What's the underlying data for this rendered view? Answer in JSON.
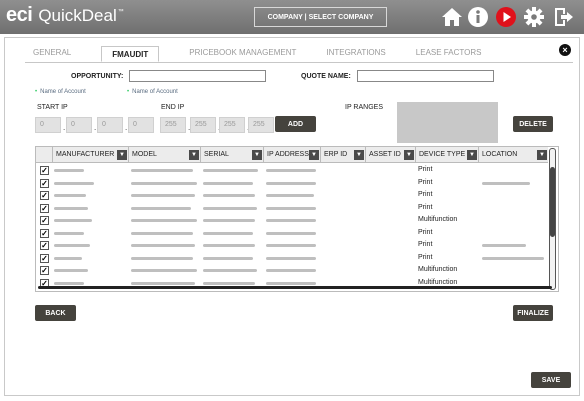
{
  "app": {
    "logo_eci": "eci",
    "logo_name": "QuickDeal",
    "logo_tm": "™",
    "company_selector": "COMPANY | SELECT COMPANY"
  },
  "tabs": [
    {
      "label": "GENERAL",
      "active": false
    },
    {
      "label": "FMAUDIT",
      "active": true
    },
    {
      "label": "PRICEBOOK MANAGEMENT",
      "active": false
    },
    {
      "label": "INTEGRATIONS",
      "active": false
    },
    {
      "label": "LEASE FACTORS",
      "active": false
    }
  ],
  "form": {
    "opportunity_label": "OPPORTUNITY:",
    "opportunity_value": "",
    "quote_name_label": "QUOTE NAME:",
    "quote_name_value": "",
    "note1": "Name of Account",
    "note2": "Name of Account",
    "start_ip_label": "START IP",
    "end_ip_label": "END IP",
    "ip_ranges_label": "IP RANGES",
    "start_ip": [
      "0",
      "0",
      "0",
      "0"
    ],
    "end_ip": [
      "255",
      "255",
      "255",
      "255"
    ],
    "add_label": "ADD",
    "delete_label": "DELETE"
  },
  "grid": {
    "columns": [
      "MANUFACTURER",
      "MODEL",
      "SERIAL",
      "IP ADDRESS",
      "ERP ID",
      "ASSET ID",
      "DEVICE TYPE",
      "LOCATION"
    ],
    "rows": [
      {
        "checked": true,
        "device_type": "Print"
      },
      {
        "checked": true,
        "device_type": "Print"
      },
      {
        "checked": true,
        "device_type": "Print"
      },
      {
        "checked": true,
        "device_type": "Print"
      },
      {
        "checked": true,
        "device_type": "Multifunction"
      },
      {
        "checked": true,
        "device_type": "Print"
      },
      {
        "checked": true,
        "device_type": "Print"
      },
      {
        "checked": true,
        "device_type": "Print"
      },
      {
        "checked": true,
        "device_type": "Multifunction"
      },
      {
        "checked": true,
        "device_type": "Multifunction"
      }
    ]
  },
  "footer": {
    "back_label": "BACK",
    "finalize_label": "FINALIZE",
    "save_label": "SAVE"
  },
  "icons": [
    "home-icon",
    "info-icon",
    "play-icon",
    "gear-icon",
    "logout-icon",
    "close-icon",
    "dropdown-arrow-icon"
  ],
  "colors": {
    "topbar": "#7d7d7d",
    "button": "#45433d",
    "play_red": "#e0111b"
  }
}
